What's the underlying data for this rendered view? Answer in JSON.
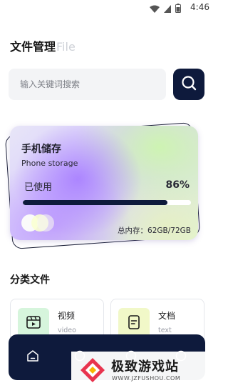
{
  "status_bar": {
    "time": "4:46",
    "icons": [
      "wifi-icon",
      "cellular-signal-icon",
      "battery-icon"
    ]
  },
  "header": {
    "title_cn": "文件管理",
    "title_en": "File"
  },
  "search": {
    "placeholder": "输入关键词搜索",
    "icon": "search-icon"
  },
  "storage_card": {
    "title": "手机储存",
    "subtitle": "Phone storage",
    "used_label": "已使用",
    "used_percent": "86%",
    "used_fraction": 0.86,
    "total_label": "总内存：62GB/72GB"
  },
  "categories": {
    "title": "分类文件",
    "items": [
      {
        "label": "视频",
        "sub": "video",
        "icon": "video-icon",
        "color": "#d6f5dc"
      },
      {
        "label": "文档",
        "sub": "text",
        "icon": "document-icon",
        "color": "#f1f8c8"
      }
    ]
  },
  "bottom_nav": {
    "items": [
      "home-icon",
      "nav-icon-2",
      "nav-icon-3",
      "nav-icon-4"
    ]
  },
  "watermark": {
    "text": "极致游戏站",
    "url": "WWW.JZFUSHOU.COM"
  },
  "colors": {
    "primary_dark": "#0e1a3c",
    "background": "#ffffff"
  }
}
